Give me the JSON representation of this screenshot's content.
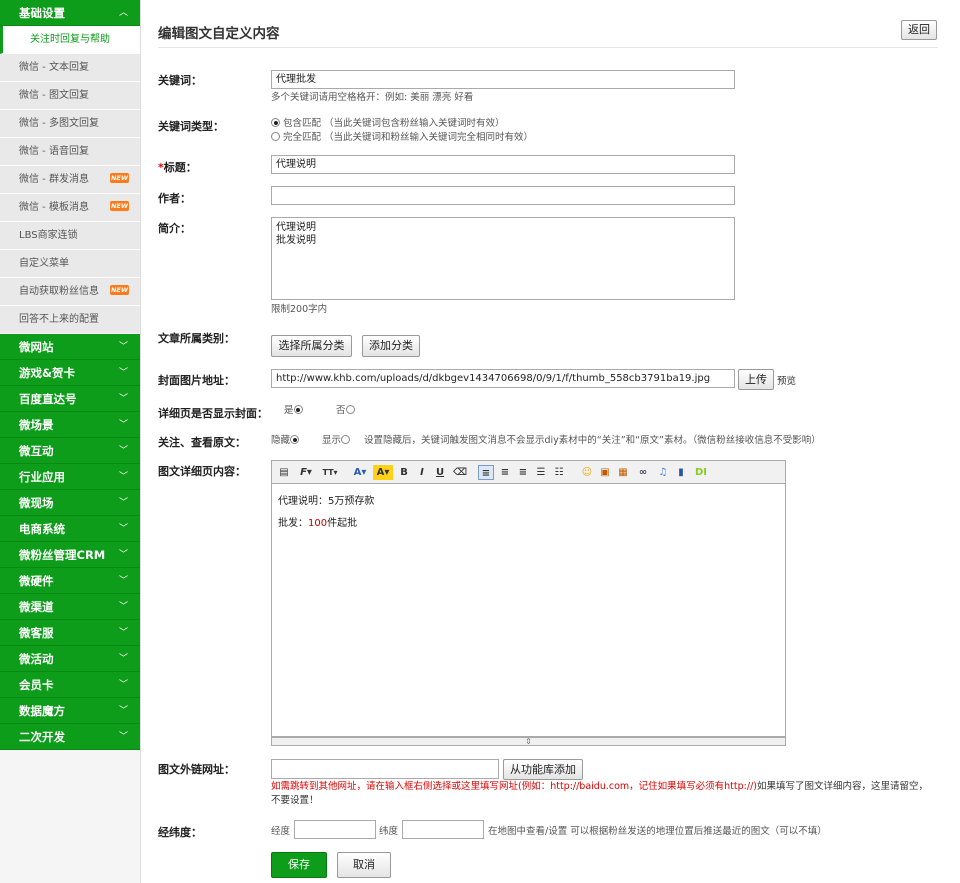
{
  "sidebar": {
    "first_group": "基础设置",
    "sub_items": [
      {
        "label": "关注时回复与帮助",
        "new": false
      },
      {
        "label": "微信 - 文本回复",
        "new": false
      },
      {
        "label": "微信 - 图文回复",
        "new": false
      },
      {
        "label": "微信 - 多图文回复",
        "new": false
      },
      {
        "label": "微信 - 语音回复",
        "new": false
      },
      {
        "label": "微信 - 群发消息",
        "new": true
      },
      {
        "label": "微信 - 模板消息",
        "new": true
      },
      {
        "label": "LBS商家连锁",
        "new": false
      },
      {
        "label": "自定义菜单",
        "new": false
      },
      {
        "label": "自动获取粉丝信息",
        "new": true
      },
      {
        "label": "回答不上来的配置",
        "new": false
      }
    ],
    "groups": [
      "微网站",
      "游戏&贺卡",
      "百度直达号",
      "微场景",
      "微互动",
      "行业应用",
      "微现场",
      "电商系统",
      "微粉丝管理CRM",
      "微硬件",
      "微渠道",
      "微客服",
      "微活动",
      "会员卡",
      "数据魔方",
      "二次开发"
    ],
    "new_badge": "NEW",
    "chevron_up": "︿",
    "chevron_down": "﹀",
    "accent": "#0d9d1a"
  },
  "header": {
    "title": "编辑图文自定义内容",
    "back_button": "返回"
  },
  "form": {
    "keyword_label": "关键词：",
    "keyword_value": "代理批发",
    "keyword_hint": "多个关键词请用空格格开：例如: 美丽 漂亮 好看",
    "kwtype_label": "关键词类型：",
    "kwtype_opt1": "包含匹配",
    "kwtype_opt1_hint": "（当此关键词包含粉丝输入关键词时有效）",
    "kwtype_opt2": "完全匹配",
    "kwtype_opt2_hint": "（当此关键词和粉丝输入关键词完全相同时有效）",
    "required_mark": "*",
    "title_label": "标题：",
    "title_value": "代理说明",
    "author_label": "作者：",
    "author_value": "",
    "intro_label": "简介：",
    "intro_line1": "代理说明",
    "intro_line2": "批发说明",
    "intro_limit": "限制200字内",
    "category_label": "文章所属类别：",
    "select_category_btn": "选择所属分类",
    "add_category_btn": "添加分类",
    "cover_label": "封面图片地址：",
    "cover_value": "http://www.khb.com/uploads/d/dkbgev1434706698/0/9/1/f/thumb_558cb3791ba19.jpg",
    "upload_btn": "上传",
    "preview_link": "预览",
    "show_cover_label": "详细页是否显示封面：",
    "show_cover_yes": "是",
    "show_cover_no": "否",
    "follow_label": "关注、查看原文：",
    "follow_hide": "隐藏",
    "follow_show": "显示",
    "follow_hint": "设置隐藏后，关键词触发图文消息不会显示diy素材中的“关注”和“原文”素材。（微信粉丝接收信息不受影响）",
    "detail_label": "图文详细页内容：",
    "editor_line1": "代理说明：5万预存款",
    "editor_line2a": "批发：",
    "editor_line2b": "100",
    "editor_line2c": "件起批",
    "extlink_label": "图文外链网址：",
    "extlink_value": "",
    "from_lib_btn": "从功能库添加",
    "extlink_warn": "如需跳转到其他网址，请在输入框右侧选择或这里填写网址(例如：http://baidu.com，记住如果填写必须有http://)",
    "extlink_note": "如果填写了图文详细内容，这里请留空，不要设置！",
    "geo_label": "经纬度：",
    "lng_label": "经度",
    "lat_label": "纬度",
    "geo_hint": "在地图中查看/设置  可以根据粉丝发送的地理位置后推送最近的图文（可以不填）",
    "save_btn": "保存",
    "cancel_btn": "取消"
  }
}
